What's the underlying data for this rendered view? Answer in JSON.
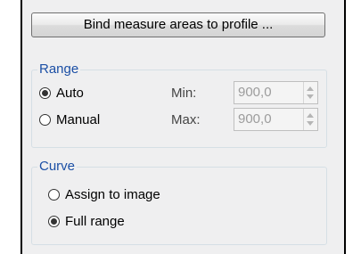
{
  "bind_button": {
    "label": "Bind measure areas to profile ..."
  },
  "range": {
    "title": "Range",
    "options": [
      {
        "label": "Auto",
        "checked": true
      },
      {
        "label": "Manual",
        "checked": false
      }
    ],
    "min_label": "Min:",
    "min_value": "900,0",
    "max_label": "Max:",
    "max_value": "900,0"
  },
  "curve": {
    "title": "Curve",
    "options": [
      {
        "label": "Assign to image",
        "checked": false
      },
      {
        "label": "Full range",
        "checked": true
      }
    ]
  }
}
